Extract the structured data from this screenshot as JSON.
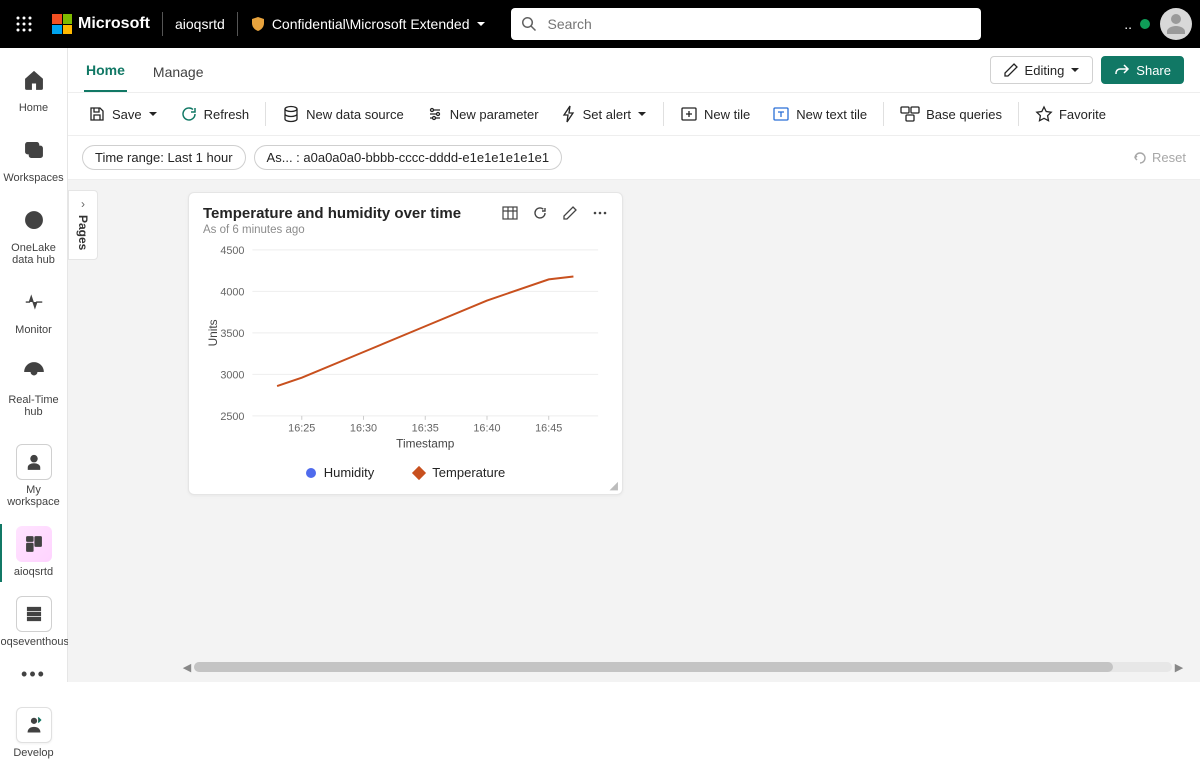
{
  "topbar": {
    "brand": "Microsoft",
    "tenant": "aioqsrtd",
    "sensitivity": "Confidential\\Microsoft Extended",
    "search_placeholder": "Search"
  },
  "rail": {
    "items": [
      {
        "label": "Home",
        "name": "rail-home"
      },
      {
        "label": "Workspaces",
        "name": "rail-workspaces"
      },
      {
        "label": "OneLake data hub",
        "name": "rail-onelake"
      },
      {
        "label": "Monitor",
        "name": "rail-monitor"
      },
      {
        "label": "Real-Time hub",
        "name": "rail-realtime"
      },
      {
        "label": "My workspace",
        "name": "rail-my-workspace"
      },
      {
        "label": "aioqsrtd",
        "name": "rail-aioqsrtd"
      },
      {
        "label": "aioqseventhouse",
        "name": "rail-eventhouse"
      }
    ],
    "more": "•••",
    "develop": "Develop"
  },
  "tabs": {
    "home": "Home",
    "manage": "Manage"
  },
  "page_actions": {
    "editing": "Editing",
    "share": "Share"
  },
  "toolbar": {
    "save": "Save",
    "refresh": "Refresh",
    "new_data_source": "New data source",
    "new_parameter": "New parameter",
    "set_alert": "Set alert",
    "new_tile": "New tile",
    "new_text_tile": "New text tile",
    "base_queries": "Base queries",
    "favorite": "Favorite"
  },
  "filters": {
    "time_range": "Time range: Last 1 hour",
    "asset": "As... : a0a0a0a0-bbbb-cccc-dddd-e1e1e1e1e1e1",
    "reset": "Reset"
  },
  "pages_panel": {
    "label": "Pages"
  },
  "tile": {
    "title": "Temperature and humidity over time",
    "subtitle": "As of 6 minutes ago",
    "ylabel": "Units",
    "xlabel": "Timestamp",
    "legend": {
      "humidity": "Humidity",
      "temperature": "Temperature"
    },
    "colors": {
      "humidity": "#4f6bed",
      "temperature": "#c8501e"
    }
  },
  "chart_data": {
    "type": "line",
    "title": "Temperature and humidity over time",
    "xlabel": "Timestamp",
    "ylabel": "Units",
    "ylim": [
      2500,
      4500
    ],
    "x_ticks": [
      "16:25",
      "16:30",
      "16:35",
      "16:40",
      "16:45"
    ],
    "y_ticks": [
      2500,
      3000,
      3500,
      4000,
      4500
    ],
    "series": [
      {
        "name": "Temperature",
        "color": "#c8501e",
        "x": [
          "16:23",
          "16:25",
          "16:30",
          "16:35",
          "16:40",
          "16:45",
          "16:47"
        ],
        "values": [
          2860,
          2960,
          3270,
          3580,
          3890,
          4145,
          4180
        ]
      },
      {
        "name": "Humidity",
        "color": "#4f6bed",
        "x": [],
        "values": []
      }
    ]
  }
}
